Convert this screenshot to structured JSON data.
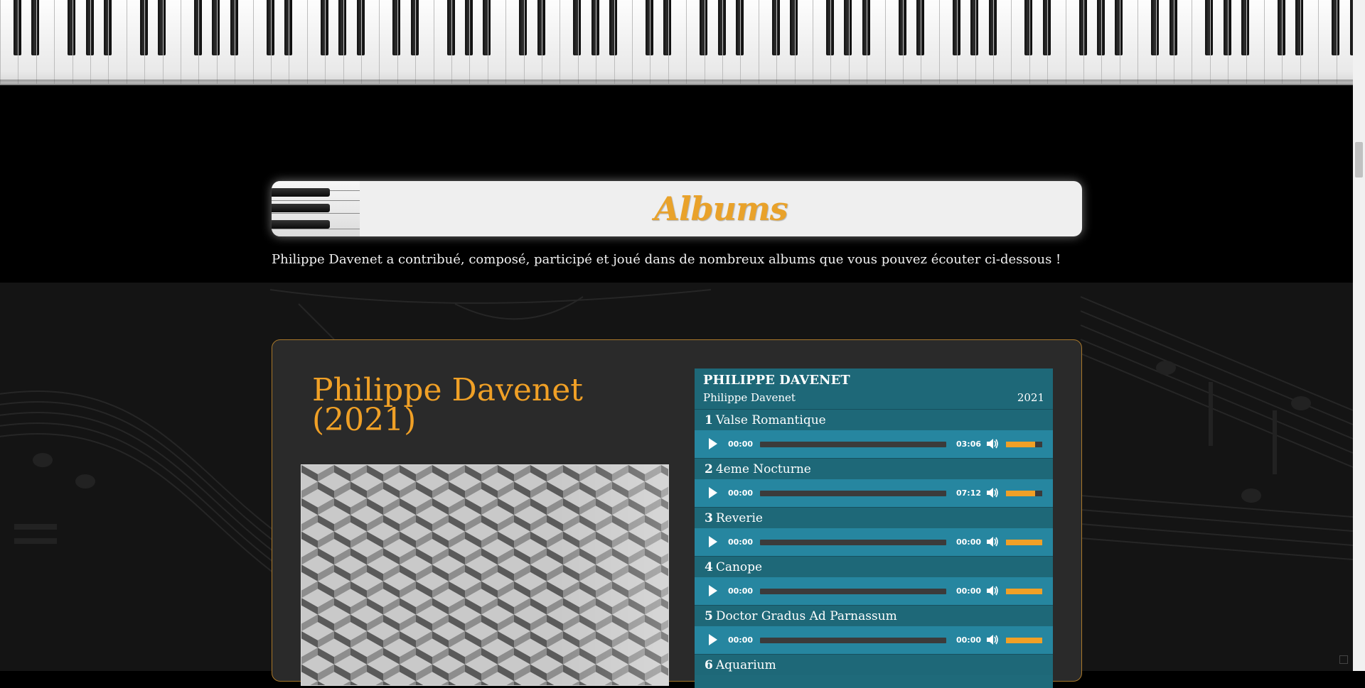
{
  "section": {
    "title": "Albums",
    "intro": "Philippe Davenet a contribué, composé, participé et joué dans de nombreux albums que vous pouvez écouter ci-dessous !"
  },
  "album": {
    "title": "Philippe Davenet (2021)",
    "cover_description": "cover-image",
    "player": {
      "title": "PHILIPPE DAVENET",
      "artist": "Philippe Davenet",
      "year": "2021",
      "tracks": [
        {
          "num": "1",
          "name": "Valse Romantique",
          "current": "00:00",
          "duration": "03:06",
          "volume": 0.8
        },
        {
          "num": "2",
          "name": "4eme Nocturne",
          "current": "00:00",
          "duration": "07:12",
          "volume": 0.8
        },
        {
          "num": "3",
          "name": "Reverie",
          "current": "00:00",
          "duration": "00:00",
          "volume": 1.0
        },
        {
          "num": "4",
          "name": "Canope",
          "current": "00:00",
          "duration": "00:00",
          "volume": 1.0
        },
        {
          "num": "5",
          "name": "Doctor Gradus Ad Parnassum",
          "current": "00:00",
          "duration": "00:00",
          "volume": 1.0
        },
        {
          "num": "6",
          "name": "Aquarium"
        }
      ]
    }
  },
  "colors": {
    "accent": "#f0a026",
    "player_bg": "#1e6878",
    "controls_bg": "#2686a0",
    "card_border": "#a9782a"
  }
}
